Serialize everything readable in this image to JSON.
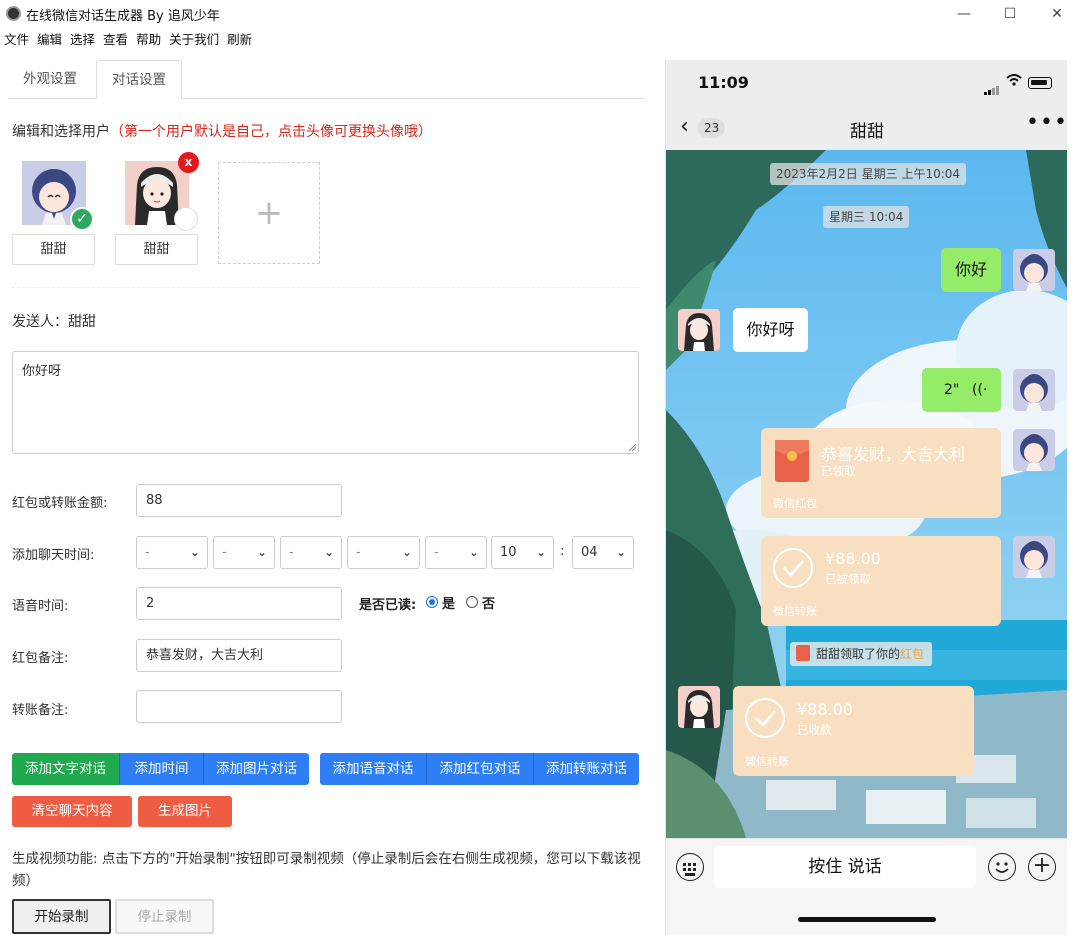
{
  "window": {
    "title": "在线微信对话生成器 By 追风少年",
    "minimize": "—",
    "maximize": "☐",
    "close": "✕"
  },
  "menu": [
    "文件",
    "编辑",
    "选择",
    "查看",
    "帮助",
    "关于我们",
    "刷新"
  ],
  "tabs": [
    {
      "label": "外观设置",
      "active": false
    },
    {
      "label": "对话设置",
      "active": true
    }
  ],
  "users_section": {
    "title": "编辑和选择用户",
    "hint": "（第一个用户默认是自己，点击头像可更换头像哦）",
    "users": [
      {
        "name": "甜甜",
        "selected": true
      },
      {
        "name": "甜甜",
        "selected": false,
        "delete": "x"
      }
    ],
    "add_symbol": "+"
  },
  "sender": {
    "label": "发送人：",
    "name": "甜甜"
  },
  "message": {
    "value": "你好呀"
  },
  "form": {
    "amount_label": "红包或转账金额:",
    "amount_value": "88",
    "time_label": "添加聊天时间:",
    "time_selects": [
      "-",
      "-",
      "-",
      "-",
      "-",
      "10",
      "04"
    ],
    "time_colon": ":",
    "voice_label": "语音时间:",
    "voice_value": "2",
    "read_label": "是否已读:",
    "read_yes": "是",
    "read_no": "否",
    "redpacket_note_label": "红包备注:",
    "redpacket_note_value": "恭喜发财，大吉大利",
    "transfer_note_label": "转账备注:",
    "transfer_note_value": ""
  },
  "buttons": {
    "add_text": "添加文字对话",
    "add_time": "添加时间",
    "add_image": "添加图片对话",
    "add_voice": "添加语音对话",
    "add_redpacket": "添加红包对话",
    "add_transfer": "添加转账对话",
    "clear": "清空聊天内容",
    "generate": "生成图片"
  },
  "video": {
    "description": "生成视频功能: 点击下方的\"开始录制\"按钮即可录制视频（停止录制后会在右侧生成视频，您可以下载该视频）",
    "start": "开始录制",
    "stop": "停止录制"
  },
  "phone": {
    "time": "11:09",
    "back_count": "23",
    "chat_title": "甜甜",
    "more": "•••",
    "timestamps": [
      "2023年2月2日 星期三 上午10:04",
      "星期三 10:04"
    ],
    "messages": {
      "self_text": "你好",
      "other_text": "你好呀",
      "voice_duration": "2\"",
      "redpacket_title": "恭喜发财，大吉大利",
      "redpacket_status": "已领取",
      "redpacket_label": "微信红包",
      "transfer_amount": "¥88.00",
      "transfer_status": "已被领取",
      "transfer_label": "微信转账",
      "system_text": "甜甜领取了你的",
      "system_highlight": "红包",
      "received_amount": "¥88.00",
      "received_status": "已收款",
      "received_label": "微信转账"
    },
    "input_placeholder": "按住 说话"
  },
  "colors": {
    "accent_blue": "#2e7ff5",
    "accent_green": "#21a94f",
    "accent_red": "#ee5c43",
    "wechat_green": "#95ec69",
    "card_orange": "#f8dfc1"
  }
}
